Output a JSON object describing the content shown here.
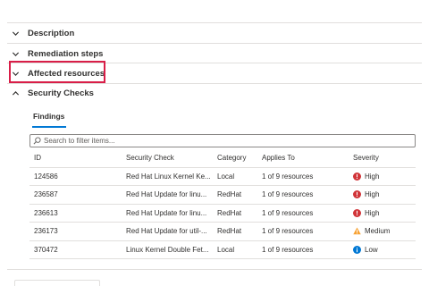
{
  "sections": {
    "description": "Description",
    "remediation": "Remediation steps",
    "affected": "Affected resources",
    "security_checks": "Security Checks"
  },
  "tabs": {
    "findings": "Findings"
  },
  "search": {
    "placeholder": "Search to filter items..."
  },
  "table": {
    "headers": [
      "ID",
      "Security Check",
      "Category",
      "Applies To",
      "Severity"
    ],
    "rows": [
      {
        "id": "124586",
        "check": "Red Hat Linux Kernel Ke...",
        "category": "Local",
        "applies": "1 of 9 resources",
        "severity": "High",
        "severity_icon": "error-icon"
      },
      {
        "id": "236587",
        "check": "Red Hat Update for linu...",
        "category": "RedHat",
        "applies": "1 of 9 resources",
        "severity": "High",
        "severity_icon": "error-icon"
      },
      {
        "id": "236613",
        "check": "Red Hat Update for linu...",
        "category": "RedHat",
        "applies": "1 of 9 resources",
        "severity": "High",
        "severity_icon": "error-icon"
      },
      {
        "id": "236173",
        "check": "Red Hat Update for util-...",
        "category": "RedHat",
        "applies": "1 of 9 resources",
        "severity": "Medium",
        "severity_icon": "warning-icon"
      },
      {
        "id": "370472",
        "check": "Linux Kernel Double Fet...",
        "category": "Local",
        "applies": "1 of 9 resources",
        "severity": "Low",
        "severity_icon": "info-icon"
      }
    ]
  },
  "colors": {
    "high": "#d13438",
    "medium": "#f7a234",
    "low": "#0078d4",
    "highlight": "#d91e48",
    "accent": "#0078d4"
  }
}
